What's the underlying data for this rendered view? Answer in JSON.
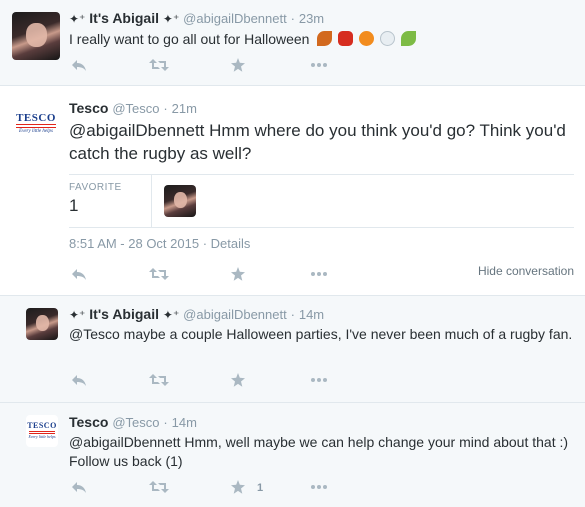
{
  "tweets": [
    {
      "name": "It's Abigail",
      "sparkle": "✦⁺",
      "handle": "@abigailDbennett",
      "dot": "·",
      "time": "23m",
      "text": "I really want to go all out for Halloween"
    },
    {
      "name": "Tesco",
      "handle": "@Tesco",
      "dot": "·",
      "time": "21m",
      "mention": "@abigailDbennett",
      "text": " Hmm where do you think you'd go? Think you'd catch the rugby as well?",
      "favorite_label": "FAVORITE",
      "favorite_count": "1",
      "timestamp": "8:51 AM - 28 Oct 2015",
      "details_link": "Details",
      "hide_conversation": "Hide conversation"
    },
    {
      "name": "It's Abigail",
      "sparkle": "✦⁺",
      "handle": "@abigailDbennett",
      "dot": "·",
      "time": "14m",
      "mention": "@Tesco",
      "text": " maybe a couple Halloween parties, I've never been much of a rugby fan."
    },
    {
      "name": "Tesco",
      "handle": "@Tesco",
      "dot": "·",
      "time": "14m",
      "mention": "@abigailDbennett",
      "text": " Hmm, well maybe we can help change your mind about that :) Follow us back (1)",
      "favorite_count": "1"
    }
  ],
  "logo": {
    "word": "TESCO",
    "tagline": "Every little helps"
  },
  "emojis": [
    "leaf-icon",
    "maple-leaf-icon",
    "pumpkin-icon",
    "ghost-icon",
    "wind-leaf-icon"
  ],
  "icons": [
    "reply-icon",
    "retweet-icon",
    "favorite-star-icon",
    "more-icon"
  ],
  "colors": {
    "accent_gray": "#8899a6",
    "icon_gray": "#aab8c2",
    "text": "#292f33",
    "background_alt": "#f5f8fa",
    "tesco_blue": "#1a3e8c",
    "tesco_red": "#e1251b"
  }
}
